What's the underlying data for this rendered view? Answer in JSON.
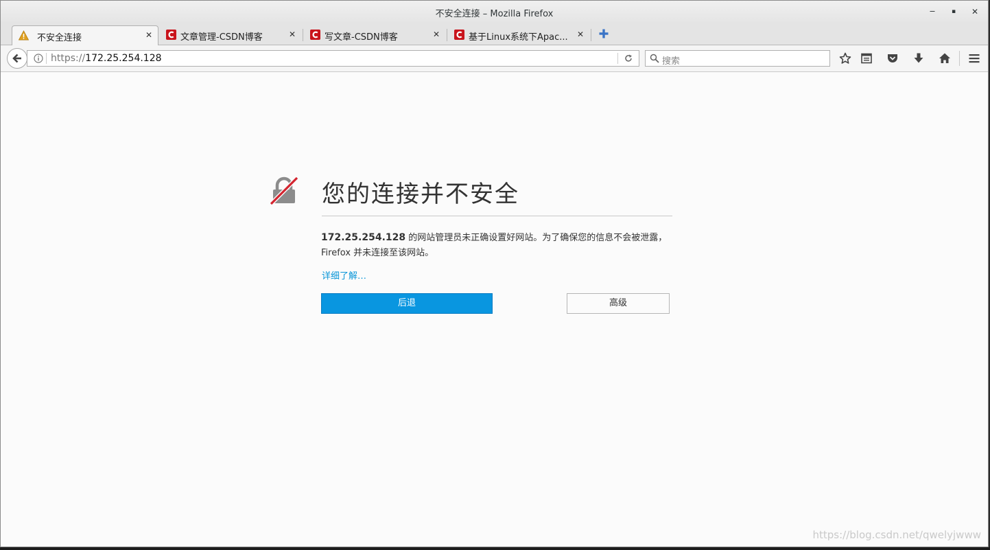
{
  "window": {
    "title": "不安全连接 – Mozilla Firefox",
    "minimize_glyph": "‒",
    "maximize_glyph": "▪",
    "close_glyph": "✕"
  },
  "tabs": [
    {
      "title": "不安全连接",
      "favicon": "warning-icon",
      "active": true
    },
    {
      "title": "文章管理-CSDN博客",
      "favicon": "csdn-icon",
      "active": false
    },
    {
      "title": "写文章-CSDN博客",
      "favicon": "csdn-icon",
      "active": false
    },
    {
      "title": "基于Linux系统下Apac...",
      "favicon": "csdn-icon",
      "active": false
    }
  ],
  "tab_close_glyph": "✕",
  "urlbar": {
    "protocol": "https://",
    "host": "172.25.254.128"
  },
  "searchbar": {
    "placeholder": "搜索"
  },
  "toolbar_icons": [
    "bookmark-star-icon",
    "reader-list-icon",
    "pocket-icon",
    "download-icon",
    "home-icon",
    "menu-icon"
  ],
  "error": {
    "heading": "您的连接并不安全",
    "host": "172.25.254.128",
    "description": " 的网站管理员未正确设置好网站。为了确保您的信息不会被泄露，Firefox 并未连接至该网站。",
    "learn_more": "详细了解…",
    "back_label": "后退",
    "advanced_label": "高级"
  },
  "watermark": "https://blog.csdn.net/qwelyjwww",
  "colors": {
    "primary_button": "#0996e0",
    "link": "#0996d8",
    "csdn_red": "#c9141c",
    "warning": "#e0a020"
  }
}
